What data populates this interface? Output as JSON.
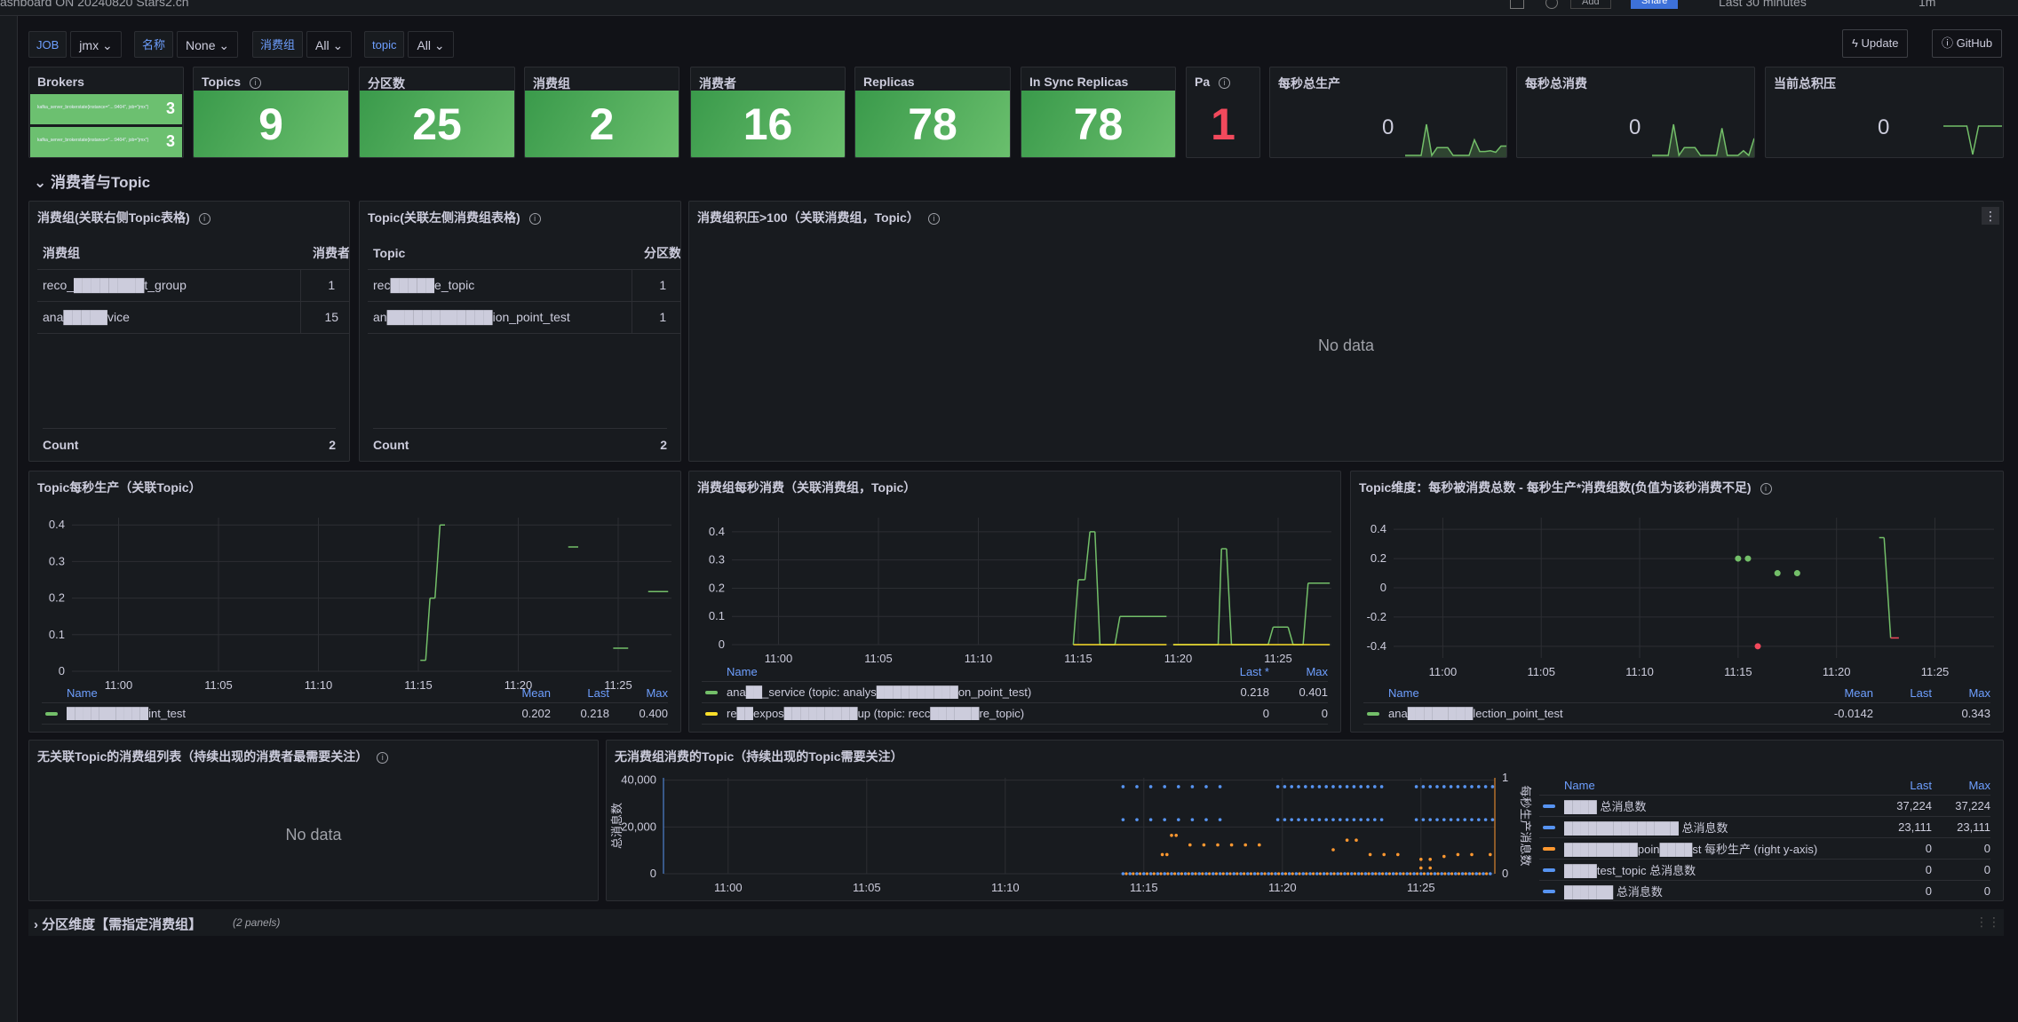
{
  "topbar": {
    "title": "ashboard ON 20240820 Stars2.cn",
    "add": "Add",
    "share": "Share",
    "time_range": "Last 30 minutes",
    "refresh": "1m"
  },
  "variables": [
    {
      "label": "JOB",
      "value": "jmx"
    },
    {
      "label": "名称",
      "value": "None"
    },
    {
      "label": "消费组",
      "value": "All"
    },
    {
      "label": "topic",
      "value": "All"
    }
  ],
  "toolbar": {
    "update": "Update",
    "github": "GitHub"
  },
  "stats": {
    "brokers": {
      "title": "Brokers",
      "items": [
        {
          "label": "kafka_server_brokerstate{instance=\"...:9404\", job=\"jmx\"}",
          "value": "3"
        },
        {
          "label": "kafka_server_brokerstate{instance=\"...:9404\", job=\"jmx\"}",
          "value": "3"
        }
      ]
    },
    "topics": {
      "title": "Topics",
      "value": "9"
    },
    "partitions": {
      "title": "分区数",
      "value": "25"
    },
    "groups": {
      "title": "消费组",
      "value": "2"
    },
    "consumers": {
      "title": "消费者",
      "value": "16"
    },
    "replicas": {
      "title": "Replicas",
      "value": "78"
    },
    "isr": {
      "title": "In Sync Replicas",
      "value": "78"
    },
    "pa": {
      "title": "Pa",
      "value": "1"
    },
    "produce": {
      "title": "每秒总生产",
      "value": "0",
      "spark": [
        0,
        0,
        0,
        0,
        0.4,
        0,
        0.1,
        0.1,
        0.1,
        0,
        0,
        0,
        0,
        0.2,
        0.05,
        0.05,
        0.06,
        0.04,
        0.12,
        0.12
      ]
    },
    "consume": {
      "title": "每秒总消费",
      "value": "0",
      "spark": [
        0,
        0,
        0,
        0,
        0.4,
        0,
        0.1,
        0.1,
        0.1,
        0,
        0,
        0,
        0,
        0.35,
        0,
        0,
        0,
        0.06,
        0,
        0.22
      ]
    },
    "lag": {
      "title": "当前总积压",
      "value": "0",
      "spark": [
        0,
        0,
        0,
        0,
        0,
        -1,
        0,
        0,
        0,
        0,
        0
      ]
    }
  },
  "section1": {
    "title": "消费者与Topic"
  },
  "group_table": {
    "title": "消费组(关联右侧Topic表格)",
    "headers": [
      "消费组",
      "消费者"
    ],
    "rows": [
      [
        "reco_████████t_group",
        "1"
      ],
      [
        "ana█████vice",
        "15"
      ]
    ],
    "count_label": "Count",
    "count": "2"
  },
  "topic_table": {
    "title": "Topic(关联左侧消费组表格)",
    "headers": [
      "Topic",
      "分区数"
    ],
    "rows": [
      [
        "rec█████e_topic",
        "1"
      ],
      [
        "an████████████ion_point_test",
        "1"
      ]
    ],
    "count_label": "Count",
    "count": "2"
  },
  "lag_panel": {
    "title": "消费组积压>100（关联消费组，Topic）",
    "nodata": "No data"
  },
  "orphan_panel": {
    "title": "无关联Topic的消费组列表（持续出现的消费者最需要关注）",
    "nodata": "No data"
  },
  "section2": {
    "title": "分区维度【需指定消费组】",
    "sub": "(2 panels)"
  },
  "chart_data": [
    {
      "type": "line",
      "title": "Topic每秒生产（关联Topic）",
      "xlim": [
        "10:57:40",
        "11:27:40"
      ],
      "xticks": [
        "11:00",
        "11:05",
        "11:10",
        "11:15",
        "11:20",
        "11:25"
      ],
      "ylim": [
        0,
        0.42
      ],
      "yticks": [
        0,
        0.1,
        0.2,
        0.3,
        0.4
      ],
      "grid": true,
      "legend_headers": [
        "Name",
        "Mean",
        "Last",
        "Max"
      ],
      "series": [
        {
          "name": "██████████int_test",
          "color": "#73bf69",
          "stats": [
            "0.202",
            "0.218",
            "0.400"
          ],
          "points": [
            [
              "11:15:06",
              0.03
            ],
            [
              "11:15:22",
              0.03
            ],
            [
              "11:15:35",
              0.2
            ],
            [
              "11:15:50",
              0.2
            ],
            [
              "11:16:05",
              0.4
            ],
            [
              "11:16:20",
              0.4
            ],
            null,
            [
              "11:22:30",
              0.34
            ],
            [
              "11:23:00",
              0.34
            ],
            null,
            [
              "11:24:45",
              0.063
            ],
            [
              "11:25:30",
              0.063
            ],
            null,
            [
              "11:26:30",
              0.218
            ],
            [
              "11:27:30",
              0.218
            ]
          ]
        }
      ]
    },
    {
      "type": "line",
      "title": "消费组每秒消费（关联消费组，Topic）",
      "xlim": [
        "10:57:40",
        "11:27:40"
      ],
      "xticks": [
        "11:00",
        "11:05",
        "11:10",
        "11:15",
        "11:20",
        "11:25"
      ],
      "ylim": [
        0,
        0.45
      ],
      "yticks": [
        0,
        0.1,
        0.2,
        0.3,
        0.4
      ],
      "grid": true,
      "legend_headers": [
        "Name",
        "Last *",
        "Max"
      ],
      "series": [
        {
          "name": "ana██_service (topic: analys██████████on_point_test)",
          "color": "#73bf69",
          "stats": [
            "0.218",
            "0.401"
          ],
          "points": [
            [
              "11:14:45",
              0
            ],
            [
              "11:15:00",
              0.23
            ],
            [
              "11:15:20",
              0.23
            ],
            [
              "11:15:35",
              0.4
            ],
            [
              "11:15:50",
              0.4
            ],
            [
              "11:16:05",
              0
            ],
            [
              "11:16:50",
              0
            ],
            [
              "11:17:05",
              0.1
            ],
            [
              "11:19:25",
              0.1
            ],
            null,
            [
              "11:19:45",
              0
            ],
            [
              "11:22:00",
              0
            ],
            [
              "11:22:10",
              0.34
            ],
            [
              "11:22:25",
              0.34
            ],
            [
              "11:22:40",
              0
            ],
            [
              "11:24:30",
              0
            ],
            [
              "11:24:45",
              0.062
            ],
            [
              "11:25:30",
              0.062
            ],
            [
              "11:25:45",
              0
            ],
            [
              "11:26:15",
              0
            ],
            [
              "11:26:30",
              0.218
            ],
            [
              "11:27:35",
              0.218
            ]
          ]
        },
        {
          "name": "re██expos█████████up (topic: recc██████re_topic)",
          "color": "#fade2a",
          "stats": [
            "0",
            "0"
          ],
          "points": [
            [
              "11:14:45",
              0
            ],
            [
              "11:19:25",
              0
            ],
            null,
            [
              "11:19:45",
              0
            ],
            [
              "11:27:35",
              0
            ]
          ]
        }
      ]
    },
    {
      "type": "line",
      "title": "Topic维度：每秒被消费总数 - 每秒生产*消费组数(负值为该秒消费不足)",
      "xlim": [
        "10:57:30",
        "11:28:00"
      ],
      "xticks": [
        "11:00",
        "11:05",
        "11:10",
        "11:15",
        "11:20",
        "11:25"
      ],
      "ylim": [
        -0.48,
        0.48
      ],
      "yticks": [
        -0.4,
        -0.2,
        0,
        0.2,
        0.4
      ],
      "grid": true,
      "legend_headers": [
        "Name",
        "Mean",
        "Last",
        "Max"
      ],
      "series": [
        {
          "name": "ana████████lection_point_test",
          "color": "#73bf69",
          "negative_color": "#f2495c",
          "stats": [
            "-0.0142",
            "",
            "0.343"
          ],
          "points": [
            [
              "11:15:00",
              0.2
            ],
            null,
            [
              "11:15:30",
              0.2
            ],
            null,
            [
              "11:16:00",
              -0.4
            ],
            null,
            [
              "11:17:00",
              0.1
            ],
            null,
            [
              "11:18:00",
              0.1
            ],
            null,
            [
              "11:22:10",
              0.343
            ],
            [
              "11:22:25",
              0.343
            ],
            [
              "11:22:45",
              -0.343
            ],
            [
              "11:23:10",
              -0.343
            ]
          ]
        }
      ]
    },
    {
      "type": "scatter",
      "title": "无消费组消费的Topic（持续出现的Topic需要关注）",
      "xlim": [
        "10:57:40",
        "11:27:40"
      ],
      "xticks": [
        "11:00",
        "11:05",
        "11:10",
        "11:15",
        "11:20",
        "11:25"
      ],
      "ylim": [
        0,
        41000
      ],
      "yticks": [
        0,
        20000,
        40000
      ],
      "ytick_labels": [
        "0",
        "20,000",
        "40,000"
      ],
      "ylabel": "总消息数",
      "y2lim": [
        0,
        1
      ],
      "y2ticks": [
        0,
        1
      ],
      "y2label": "每秒生产消息数",
      "grid": true,
      "legend_headers": [
        "Name",
        "Last",
        "Max"
      ],
      "series": [
        {
          "name": "████ 总消息数",
          "color": "#5794f2",
          "axis": "left",
          "stats": [
            "37,224",
            "37,224"
          ],
          "value": 37224,
          "ranges": [
            [
              "11:14:15",
              "11:18:05",
              0.5
            ],
            [
              "11:19:50",
              "11:23:35",
              0.25
            ],
            [
              "11:24:50",
              "11:27:35",
              0.25
            ]
          ]
        },
        {
          "name": "██████████████ 总消息数",
          "color": "#5794f2",
          "axis": "left",
          "stats": [
            "23,111",
            "23,111"
          ],
          "value": 23111,
          "ranges": [
            [
              "11:14:15",
              "11:18:05",
              0.5
            ],
            [
              "11:19:50",
              "11:23:35",
              0.25
            ],
            [
              "11:24:50",
              "11:27:35",
              0.25
            ]
          ]
        },
        {
          "name": "█████████poin████st 每秒生产 (right y-axis)",
          "color": "#ff9830",
          "axis": "right",
          "stats": [
            "0",
            "0"
          ],
          "points": [
            [
              "11:15:40",
              0.2
            ],
            [
              "11:15:50",
              0.2
            ],
            [
              "11:16:00",
              0.4
            ],
            [
              "11:16:10",
              0.4
            ],
            [
              "11:16:40",
              0.3
            ],
            [
              "11:17:10",
              0.3
            ],
            [
              "11:17:40",
              0.3
            ],
            [
              "11:18:10",
              0.3
            ],
            [
              "11:18:40",
              0.3
            ],
            [
              "11:19:10",
              0.3
            ],
            [
              "11:21:50",
              0.25
            ],
            [
              "11:22:20",
              0.35
            ],
            [
              "11:22:40",
              0.35
            ],
            [
              "11:23:10",
              0.2
            ],
            [
              "11:23:40",
              0.2
            ],
            [
              "11:24:10",
              0.2
            ],
            [
              "11:25:00",
              0.15
            ],
            [
              "11:25:20",
              0.15
            ],
            [
              "11:25:50",
              0.18
            ],
            [
              "11:26:20",
              0.2
            ],
            [
              "11:26:50",
              0.2
            ],
            [
              "11:27:30",
              0.2
            ],
            [
              "11:25:00",
              0.06
            ],
            [
              "11:25:20",
              0.06
            ]
          ],
          "zero_range": [
            "11:14:15",
            "11:27:35",
            0.25
          ]
        },
        {
          "name": "████test_topic 总消息数",
          "color": "#5794f2",
          "axis": "left",
          "stats": [
            "0",
            "0"
          ],
          "value": 0,
          "ranges": [
            [
              "11:14:15",
              "11:27:35",
              0.25
            ]
          ]
        },
        {
          "name": "██████ 总消息数",
          "color": "#5794f2",
          "axis": "left",
          "stats": [
            "0",
            "0"
          ]
        }
      ]
    }
  ]
}
